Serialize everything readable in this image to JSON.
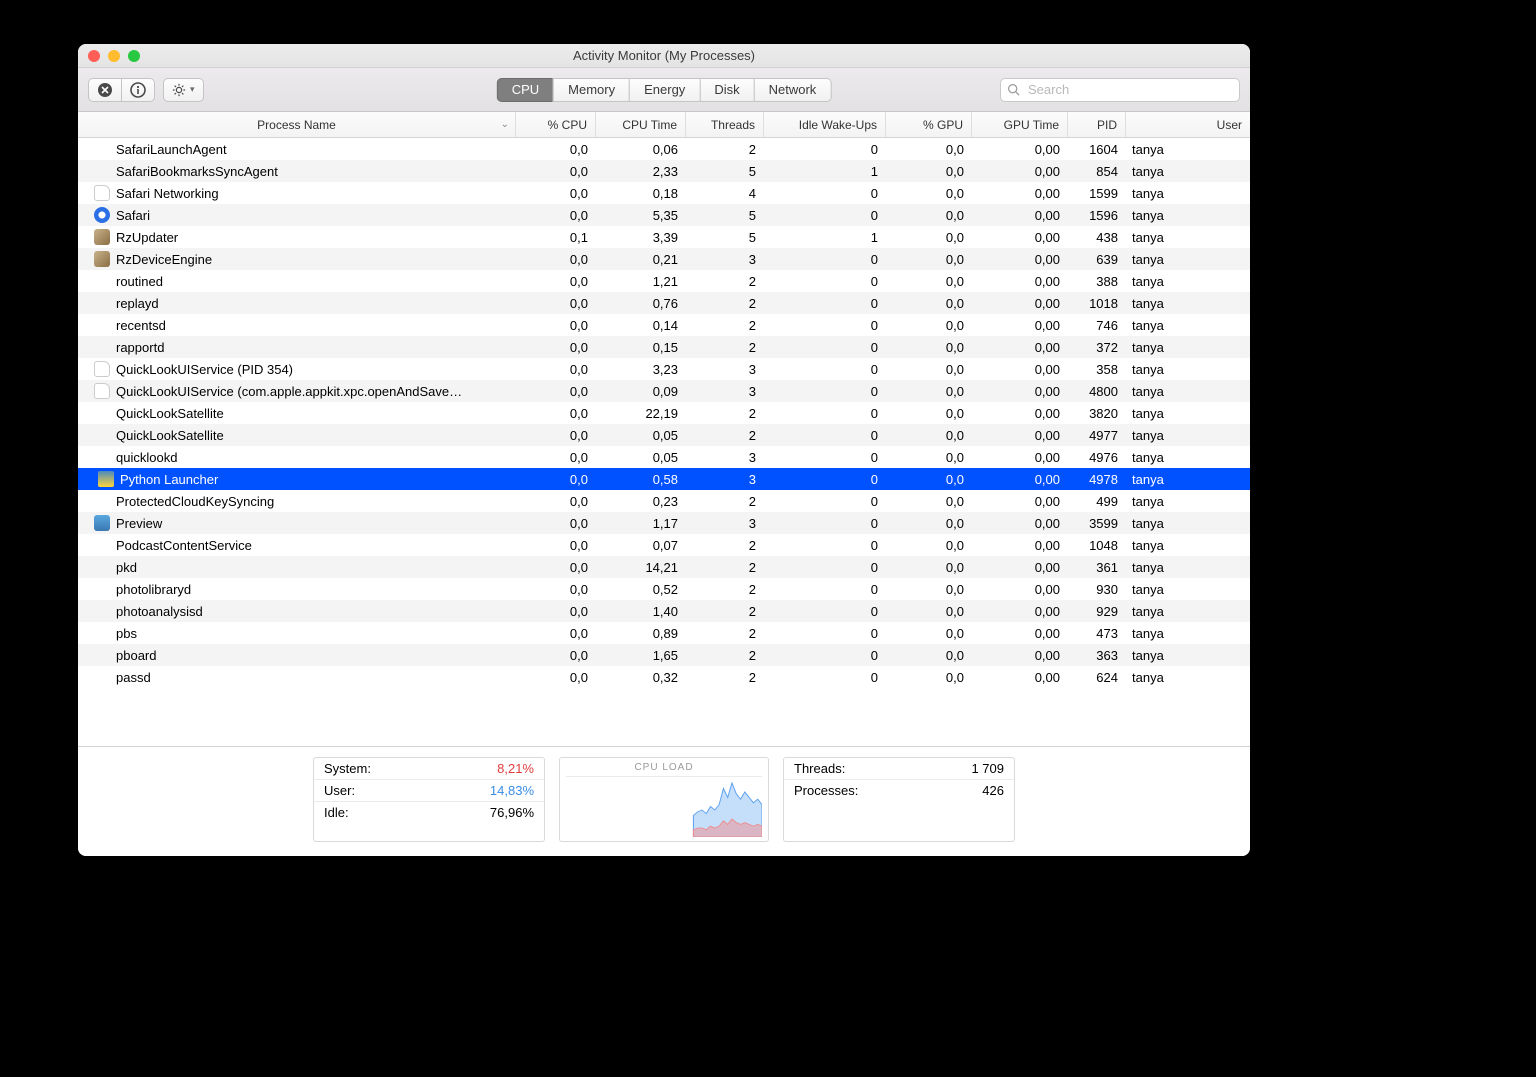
{
  "window": {
    "title": "Activity Monitor (My Processes)"
  },
  "toolbar": {
    "tabs": [
      "CPU",
      "Memory",
      "Energy",
      "Disk",
      "Network"
    ],
    "active_tab": 0,
    "search_placeholder": "Search"
  },
  "columns": {
    "name": "Process Name",
    "cpu": "% CPU",
    "ctime": "CPU Time",
    "thr": "Threads",
    "iwu": "Idle Wake-Ups",
    "gpu": "% GPU",
    "gtime": "GPU Time",
    "pid": "PID",
    "user": "User"
  },
  "selected_pid": 4978,
  "processes": [
    {
      "icon": "none",
      "name": "SafariLaunchAgent",
      "cpu": "0,0",
      "ctime": "0,06",
      "thr": "2",
      "iwu": "0",
      "gpu": "0,0",
      "gtime": "0,00",
      "pid": "1604",
      "user": "tanya"
    },
    {
      "icon": "none",
      "name": "SafariBookmarksSyncAgent",
      "cpu": "0,0",
      "ctime": "2,33",
      "thr": "5",
      "iwu": "1",
      "gpu": "0,0",
      "gtime": "0,00",
      "pid": "854",
      "user": "tanya"
    },
    {
      "icon": "doc",
      "name": "Safari Networking",
      "cpu": "0,0",
      "ctime": "0,18",
      "thr": "4",
      "iwu": "0",
      "gpu": "0,0",
      "gtime": "0,00",
      "pid": "1599",
      "user": "tanya"
    },
    {
      "icon": "safari",
      "name": "Safari",
      "cpu": "0,0",
      "ctime": "5,35",
      "thr": "5",
      "iwu": "0",
      "gpu": "0,0",
      "gtime": "0,00",
      "pid": "1596",
      "user": "tanya"
    },
    {
      "icon": "rz",
      "name": "RzUpdater",
      "cpu": "0,1",
      "ctime": "3,39",
      "thr": "5",
      "iwu": "1",
      "gpu": "0,0",
      "gtime": "0,00",
      "pid": "438",
      "user": "tanya"
    },
    {
      "icon": "rz",
      "name": "RzDeviceEngine",
      "cpu": "0,0",
      "ctime": "0,21",
      "thr": "3",
      "iwu": "0",
      "gpu": "0,0",
      "gtime": "0,00",
      "pid": "639",
      "user": "tanya"
    },
    {
      "icon": "none",
      "name": "routined",
      "cpu": "0,0",
      "ctime": "1,21",
      "thr": "2",
      "iwu": "0",
      "gpu": "0,0",
      "gtime": "0,00",
      "pid": "388",
      "user": "tanya"
    },
    {
      "icon": "none",
      "name": "replayd",
      "cpu": "0,0",
      "ctime": "0,76",
      "thr": "2",
      "iwu": "0",
      "gpu": "0,0",
      "gtime": "0,00",
      "pid": "1018",
      "user": "tanya"
    },
    {
      "icon": "none",
      "name": "recentsd",
      "cpu": "0,0",
      "ctime": "0,14",
      "thr": "2",
      "iwu": "0",
      "gpu": "0,0",
      "gtime": "0,00",
      "pid": "746",
      "user": "tanya"
    },
    {
      "icon": "none",
      "name": "rapportd",
      "cpu": "0,0",
      "ctime": "0,15",
      "thr": "2",
      "iwu": "0",
      "gpu": "0,0",
      "gtime": "0,00",
      "pid": "372",
      "user": "tanya"
    },
    {
      "icon": "doc",
      "name": "QuickLookUIService (PID 354)",
      "cpu": "0,0",
      "ctime": "3,23",
      "thr": "3",
      "iwu": "0",
      "gpu": "0,0",
      "gtime": "0,00",
      "pid": "358",
      "user": "tanya"
    },
    {
      "icon": "doc",
      "name": "QuickLookUIService (com.apple.appkit.xpc.openAndSave…",
      "cpu": "0,0",
      "ctime": "0,09",
      "thr": "3",
      "iwu": "0",
      "gpu": "0,0",
      "gtime": "0,00",
      "pid": "4800",
      "user": "tanya"
    },
    {
      "icon": "none",
      "name": "QuickLookSatellite",
      "cpu": "0,0",
      "ctime": "22,19",
      "thr": "2",
      "iwu": "0",
      "gpu": "0,0",
      "gtime": "0,00",
      "pid": "3820",
      "user": "tanya"
    },
    {
      "icon": "none",
      "name": "QuickLookSatellite",
      "cpu": "0,0",
      "ctime": "0,05",
      "thr": "2",
      "iwu": "0",
      "gpu": "0,0",
      "gtime": "0,00",
      "pid": "4977",
      "user": "tanya"
    },
    {
      "icon": "none",
      "name": "quicklookd",
      "cpu": "0,0",
      "ctime": "0,05",
      "thr": "3",
      "iwu": "0",
      "gpu": "0,0",
      "gtime": "0,00",
      "pid": "4976",
      "user": "tanya"
    },
    {
      "icon": "py",
      "name": "Python Launcher",
      "cpu": "0,0",
      "ctime": "0,58",
      "thr": "3",
      "iwu": "0",
      "gpu": "0,0",
      "gtime": "0,00",
      "pid": "4978",
      "user": "tanya"
    },
    {
      "icon": "none",
      "name": "ProtectedCloudKeySyncing",
      "cpu": "0,0",
      "ctime": "0,23",
      "thr": "2",
      "iwu": "0",
      "gpu": "0,0",
      "gtime": "0,00",
      "pid": "499",
      "user": "tanya"
    },
    {
      "icon": "preview",
      "name": "Preview",
      "cpu": "0,0",
      "ctime": "1,17",
      "thr": "3",
      "iwu": "0",
      "gpu": "0,0",
      "gtime": "0,00",
      "pid": "3599",
      "user": "tanya"
    },
    {
      "icon": "none",
      "name": "PodcastContentService",
      "cpu": "0,0",
      "ctime": "0,07",
      "thr": "2",
      "iwu": "0",
      "gpu": "0,0",
      "gtime": "0,00",
      "pid": "1048",
      "user": "tanya"
    },
    {
      "icon": "none",
      "name": "pkd",
      "cpu": "0,0",
      "ctime": "14,21",
      "thr": "2",
      "iwu": "0",
      "gpu": "0,0",
      "gtime": "0,00",
      "pid": "361",
      "user": "tanya"
    },
    {
      "icon": "none",
      "name": "photolibraryd",
      "cpu": "0,0",
      "ctime": "0,52",
      "thr": "2",
      "iwu": "0",
      "gpu": "0,0",
      "gtime": "0,00",
      "pid": "930",
      "user": "tanya"
    },
    {
      "icon": "none",
      "name": "photoanalysisd",
      "cpu": "0,0",
      "ctime": "1,40",
      "thr": "2",
      "iwu": "0",
      "gpu": "0,0",
      "gtime": "0,00",
      "pid": "929",
      "user": "tanya"
    },
    {
      "icon": "none",
      "name": "pbs",
      "cpu": "0,0",
      "ctime": "0,89",
      "thr": "2",
      "iwu": "0",
      "gpu": "0,0",
      "gtime": "0,00",
      "pid": "473",
      "user": "tanya"
    },
    {
      "icon": "none",
      "name": "pboard",
      "cpu": "0,0",
      "ctime": "1,65",
      "thr": "2",
      "iwu": "0",
      "gpu": "0,0",
      "gtime": "0,00",
      "pid": "363",
      "user": "tanya"
    },
    {
      "icon": "none",
      "name": "passd",
      "cpu": "0,0",
      "ctime": "0,32",
      "thr": "2",
      "iwu": "0",
      "gpu": "0,0",
      "gtime": "0,00",
      "pid": "624",
      "user": "tanya"
    }
  ],
  "footer": {
    "system_label": "System:",
    "system_value": "8,21%",
    "user_label": "User:",
    "user_value": "14,83%",
    "idle_label": "Idle:",
    "idle_value": "76,96%",
    "chart_title": "CPU LOAD",
    "threads_label": "Threads:",
    "threads_value": "1 709",
    "processes_label": "Processes:",
    "processes_value": "426"
  },
  "chart_data": {
    "type": "area",
    "title": "CPU LOAD",
    "series": [
      {
        "name": "User",
        "color": "#5aa0f0",
        "values": [
          8,
          9,
          10,
          9,
          11,
          10,
          12,
          18,
          15,
          20,
          16,
          14,
          17,
          15,
          13,
          14,
          12
        ]
      },
      {
        "name": "System",
        "color": "#f08b8b",
        "values": [
          4,
          5,
          5,
          4,
          6,
          5,
          6,
          9,
          7,
          10,
          8,
          7,
          8,
          7,
          6,
          7,
          6
        ]
      }
    ],
    "ylim": [
      0,
      100
    ]
  }
}
